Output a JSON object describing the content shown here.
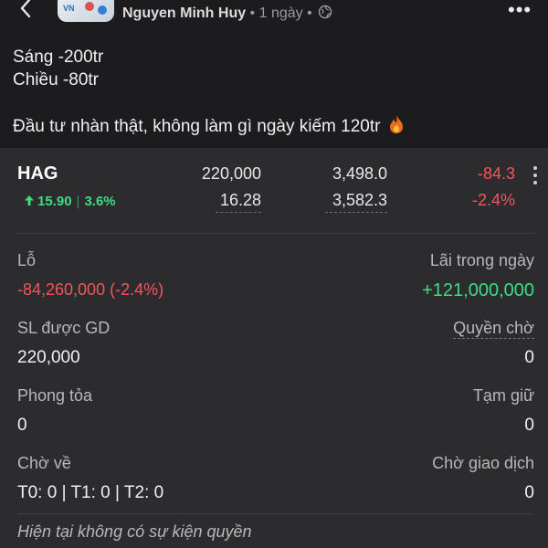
{
  "post": {
    "author": "Nguyen Minh Huy",
    "meta": " • 1 ngày • ",
    "avatar_text": "VN",
    "lines": [
      "Sáng -200tr",
      "Chiều -80tr"
    ],
    "message": "Đầu tư nhàn thật, không làm gì ngày kiếm 120tr"
  },
  "stock": {
    "ticker": "HAG",
    "change_value": "15.90",
    "change_percent": "3.6%",
    "quantity": "220,000",
    "avg_price": "16.28",
    "cost_value": "3,498.0",
    "market_value": "3,582.3",
    "pl_value": "-84.3",
    "pl_percent": "-2.4%"
  },
  "details": {
    "loss_label": "Lỗ",
    "loss_value": "-84,260,000 (-2.4%)",
    "intraday_label": "Lãi trong ngày",
    "intraday_value": "+121,000,000",
    "tradable_label": "SL được GD",
    "tradable_value": "220,000",
    "rights_label": "Quyền chờ",
    "rights_value": "0",
    "blocked_label": "Phong tỏa",
    "blocked_value": "0",
    "held_label": "Tạm giữ",
    "held_value": "0",
    "incoming_label": "Chờ về",
    "incoming_value": "T0: 0 | T1: 0 | T2: 0",
    "pending_label": "Chờ giao dịch",
    "pending_value": "0",
    "event_note": "Hiện tại không có sự kiện quyền"
  },
  "colors": {
    "background": "#1c1c1e",
    "card": "#2c2c2e",
    "positive": "#3ddc84",
    "negative": "#f2555a"
  },
  "icons": {
    "back": "back-chevron-icon",
    "globe": "globe-icon",
    "fire": "fire-icon",
    "up": "up-arrow-icon",
    "more": "more-dots-icon"
  }
}
